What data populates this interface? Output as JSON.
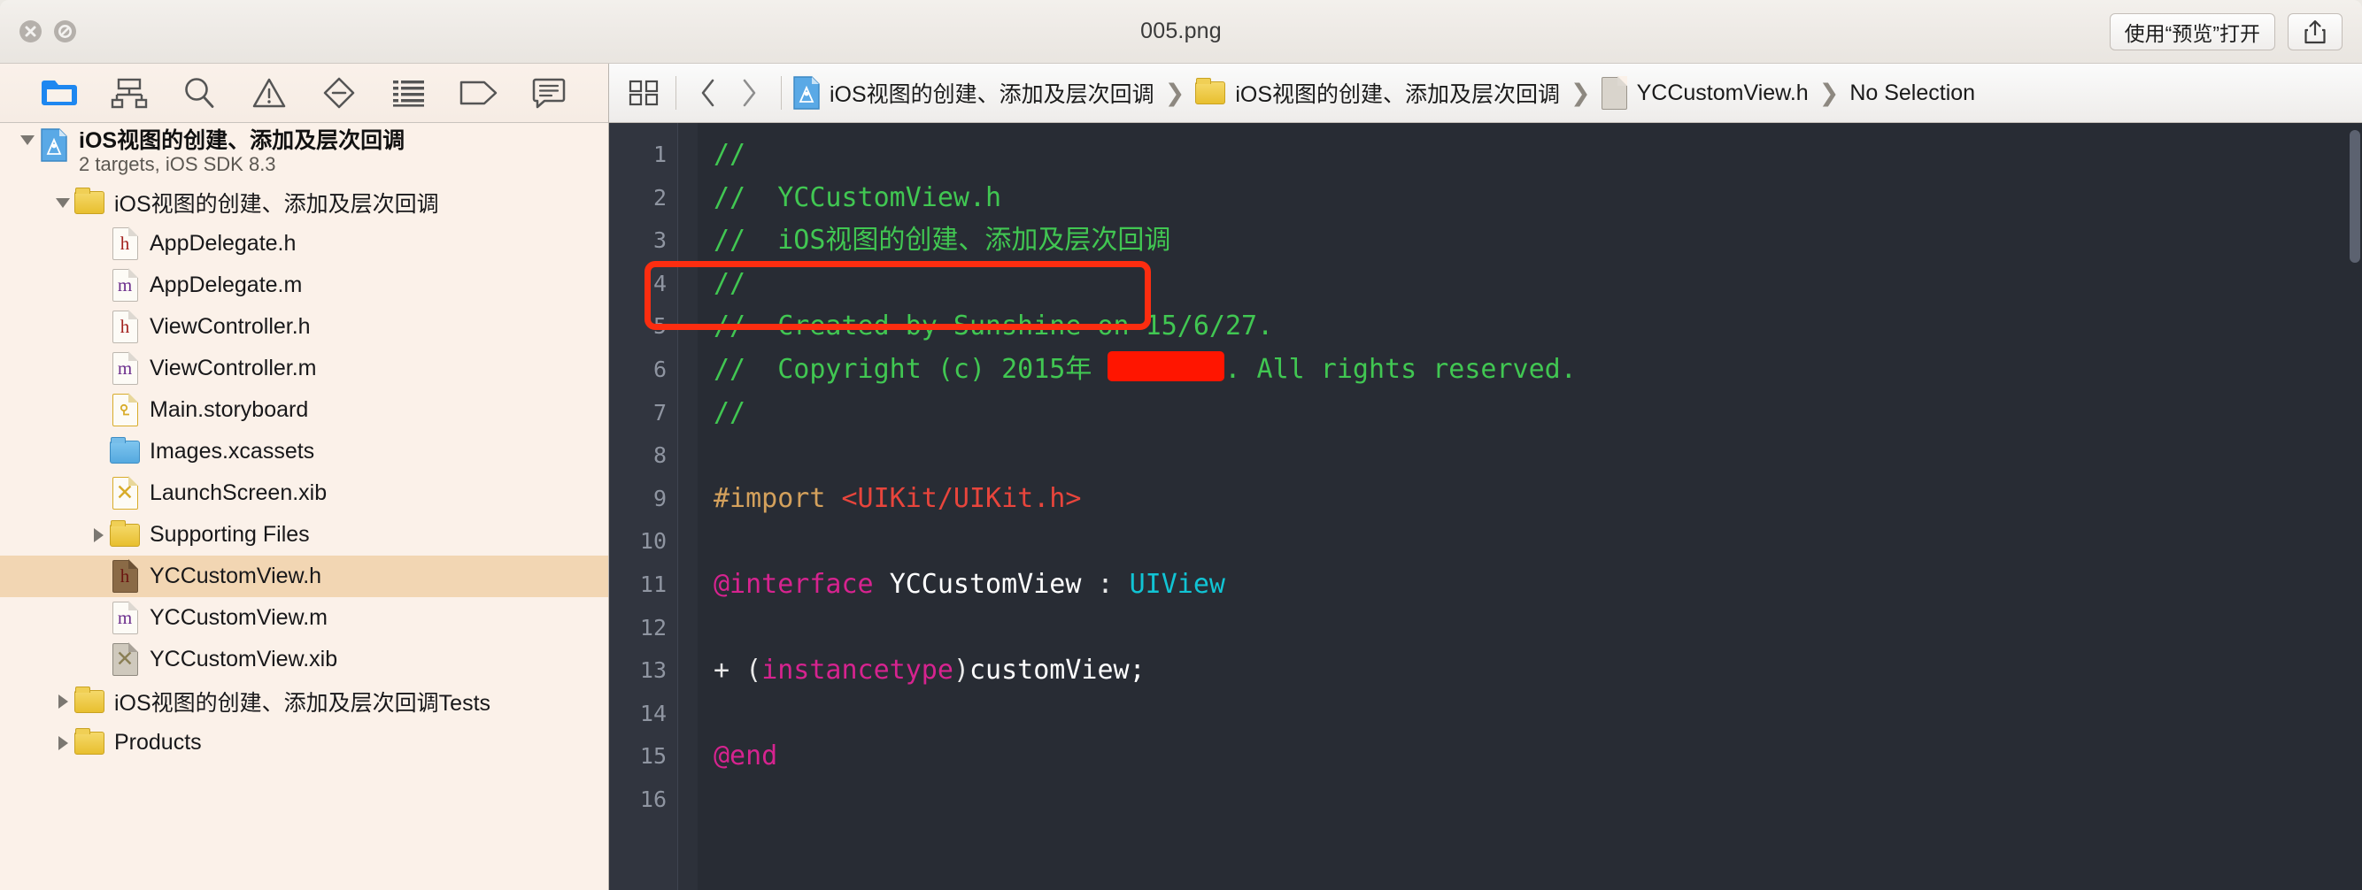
{
  "window": {
    "title": "005.png",
    "close_icon": "close-icon",
    "minimize_icon": "minimize-icon",
    "open_with_button": "使用“预览”打开",
    "share_icon": "share-icon"
  },
  "navigator_toolbar": {
    "icons": [
      {
        "name": "project-navigator-icon",
        "active": true
      },
      {
        "name": "source-control-navigator-icon",
        "active": false
      },
      {
        "name": "symbol-navigator-search-icon",
        "active": false
      },
      {
        "name": "issue-navigator-warning-icon",
        "active": false
      },
      {
        "name": "test-navigator-diamond-icon",
        "active": false
      },
      {
        "name": "debug-navigator-icon",
        "active": false
      },
      {
        "name": "breakpoint-navigator-tag-icon",
        "active": false
      },
      {
        "name": "report-navigator-comment-icon",
        "active": false
      }
    ]
  },
  "filetree": {
    "rows": [
      {
        "label": "iOS视图的创建、添加及层次回调",
        "subtitle": "2 targets, iOS SDK 8.3",
        "icon": "xcode-project-icon",
        "indent": 0,
        "twisty": "down",
        "type": "project",
        "selected": false
      },
      {
        "label": "iOS视图的创建、添加及层次回调",
        "icon": "folder-yellow-icon",
        "indent": 1,
        "twisty": "down",
        "type": "folder",
        "selected": false
      },
      {
        "label": "AppDelegate.h",
        "icon": "header-file-icon",
        "indent": 2,
        "twisty": "none",
        "type": "h",
        "selected": false
      },
      {
        "label": "AppDelegate.m",
        "icon": "implementation-file-icon",
        "indent": 2,
        "twisty": "none",
        "type": "m",
        "selected": false
      },
      {
        "label": "ViewController.h",
        "icon": "header-file-icon",
        "indent": 2,
        "twisty": "none",
        "type": "h",
        "selected": false
      },
      {
        "label": "ViewController.m",
        "icon": "implementation-file-icon",
        "indent": 2,
        "twisty": "none",
        "type": "m",
        "selected": false
      },
      {
        "label": "Main.storyboard",
        "icon": "storyboard-file-icon",
        "indent": 2,
        "twisty": "none",
        "type": "storyboard",
        "selected": false
      },
      {
        "label": "Images.xcassets",
        "icon": "asset-catalog-icon",
        "indent": 2,
        "twisty": "none",
        "type": "xcassets",
        "selected": false
      },
      {
        "label": "LaunchScreen.xib",
        "icon": "xib-file-icon",
        "indent": 2,
        "twisty": "none",
        "type": "xib",
        "selected": false
      },
      {
        "label": "Supporting Files",
        "icon": "folder-yellow-icon",
        "indent": 2,
        "twisty": "right",
        "type": "folder",
        "selected": false
      },
      {
        "label": "YCCustomView.h",
        "icon": "header-file-icon",
        "indent": 2,
        "twisty": "none",
        "type": "h-selected",
        "selected": true
      },
      {
        "label": "YCCustomView.m",
        "icon": "implementation-file-icon",
        "indent": 2,
        "twisty": "none",
        "type": "m",
        "selected": false
      },
      {
        "label": "YCCustomView.xib",
        "icon": "xib-file-icon",
        "indent": 2,
        "twisty": "none",
        "type": "xib-gray",
        "selected": false
      },
      {
        "label": "iOS视图的创建、添加及层次回调Tests",
        "icon": "folder-yellow-icon",
        "indent": 1,
        "twisty": "right",
        "type": "folder",
        "selected": false
      },
      {
        "label": "Products",
        "icon": "folder-yellow-icon",
        "indent": 1,
        "twisty": "right",
        "type": "folder",
        "selected": false
      }
    ]
  },
  "jumpbar": {
    "related_items_icon": "related-items-icon",
    "back_icon": "back-chevron-icon",
    "forward_icon": "forward-chevron-icon",
    "breadcrumbs": [
      {
        "label": "iOS视图的创建、添加及层次回调",
        "icon": "xcode-project-icon"
      },
      {
        "label": "iOS视图的创建、添加及层次回调",
        "icon": "folder-yellow-icon"
      },
      {
        "label": "YCCustomView.h",
        "icon": "header-file-icon"
      },
      {
        "label": "No Selection",
        "icon": "none"
      }
    ]
  },
  "editor": {
    "line_numbers": [
      "1",
      "2",
      "3",
      "4",
      "5",
      "6",
      "7",
      "8",
      "9",
      "10",
      "11",
      "12",
      "13",
      "14",
      "15",
      "16"
    ],
    "lines": [
      [
        {
          "t": "//",
          "c": "cmt"
        }
      ],
      [
        {
          "t": "//  YCCustomView.h",
          "c": "cmt"
        }
      ],
      [
        {
          "t": "//  iOS视图的创建、添加及层次回调",
          "c": "cmt"
        }
      ],
      [
        {
          "t": "//",
          "c": "cmt"
        }
      ],
      [
        {
          "t": "//  Created by Sunshine on 15/6/27.",
          "c": "cmt"
        }
      ],
      [
        {
          "t": "//  Copyright (c) 2015年 ",
          "c": "cmt"
        },
        {
          "t": "",
          "c": "redact"
        },
        {
          "t": ". All rights reserved.",
          "c": "cmt"
        }
      ],
      [
        {
          "t": "//",
          "c": "cmt"
        }
      ],
      [],
      [
        {
          "t": "#import ",
          "c": "pre"
        },
        {
          "t": "<UIKit/UIKit.h>",
          "c": "str"
        }
      ],
      [],
      [
        {
          "t": "@interface ",
          "c": "kw"
        },
        {
          "t": "YCCustomView",
          "c": "ident"
        },
        {
          "t": " : ",
          "c": "plain"
        },
        {
          "t": "UIView",
          "c": "cls"
        }
      ],
      [],
      [
        {
          "t": "+ (",
          "c": "plain"
        },
        {
          "t": "instancetype",
          "c": "kw"
        },
        {
          "t": ")",
          "c": "plain"
        },
        {
          "t": "customView;",
          "c": "ident"
        }
      ],
      [],
      [
        {
          "t": "@end",
          "c": "kw"
        }
      ],
      []
    ],
    "annotation": {
      "name": "red-highlight-box",
      "color": "#fc2d10",
      "line": 13
    }
  },
  "colors": {
    "editor_background": "#282c34",
    "gutter_background": "#31353f",
    "comment": "#41c752",
    "preprocessor": "#d4a15c",
    "string": "#e8453c",
    "keyword": "#d6238f",
    "class": "#11c4d4",
    "selection": "#f2d6b3",
    "annotation_red": "#fc2d10",
    "redaction_red": "#ff1500"
  }
}
